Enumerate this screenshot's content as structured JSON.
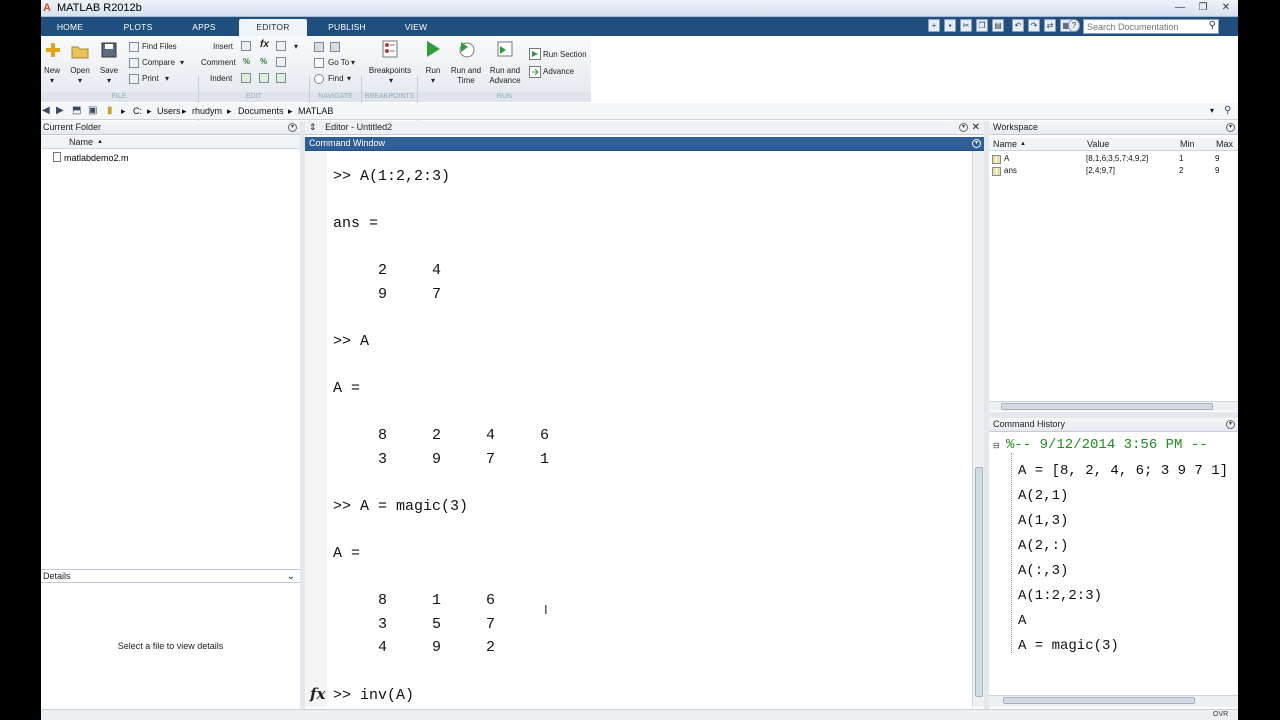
{
  "window": {
    "title": "MATLAB R2012b",
    "logo_glyph": "A"
  },
  "tabs": [
    {
      "label": "HOME",
      "active": false
    },
    {
      "label": "PLOTS",
      "active": false
    },
    {
      "label": "APPS",
      "active": false
    },
    {
      "label": "EDITOR",
      "active": true
    },
    {
      "label": "PUBLISH",
      "active": false
    },
    {
      "label": "VIEW",
      "active": false
    }
  ],
  "search": {
    "placeholder": "Search Documentation"
  },
  "ribbon": {
    "file": {
      "new": "New",
      "open": "Open",
      "save": "Save",
      "find_files": "Find Files",
      "compare": "Compare",
      "print": "Print",
      "section": "FILE"
    },
    "edit": {
      "insert": "Insert",
      "comment": "Comment",
      "indent": "Indent",
      "section": "EDIT"
    },
    "navigate": {
      "go_to": "Go To",
      "find": "Find",
      "section": "NAVIGATE"
    },
    "breakpoints": {
      "breakpoints": "Breakpoints",
      "section": "BREAKPOINTS"
    },
    "run": {
      "run": "Run",
      "run_and_time": [
        "Run and",
        "Time"
      ],
      "run_and_advance": [
        "Run and",
        "Advance"
      ],
      "run_section": "Run Section",
      "advance": "Advance",
      "section": "RUN"
    }
  },
  "address": {
    "crumbs": [
      "C:",
      "Users",
      "rhudym",
      "Documents",
      "MATLAB"
    ]
  },
  "current_folder": {
    "title": "Current Folder",
    "column": "Name",
    "sort_glyph": "▲",
    "files": [
      "matlabdemo2.m"
    ]
  },
  "details": {
    "title": "Details",
    "message": "Select a file to view details"
  },
  "editor": {
    "title": "Editor - Untitled2"
  },
  "command_window": {
    "title": "Command Window",
    "prompt_glyph": "fx",
    "lines": [
      ">> A(1:2,2:3)",
      "ans =",
      "     2     4",
      "     9     7",
      ">> A",
      "A =",
      "     8     2     4     6",
      "     3     9     7     1",
      ">> A = magic(3)",
      "A =",
      "     8     1     6",
      "     3     5     7",
      "     4     9     2",
      ">> inv(A)"
    ]
  },
  "workspace": {
    "title": "Workspace",
    "columns": [
      "Name",
      "Value",
      "Min",
      "Max"
    ],
    "rows": [
      {
        "name": "A",
        "value": "[8,1,6;3,5,7;4,9,2]",
        "min": "1",
        "max": "9"
      },
      {
        "name": "ans",
        "value": "[2,4;9,7]",
        "min": "2",
        "max": "9"
      }
    ]
  },
  "history": {
    "title": "Command History",
    "session": "%-- 9/12/2014 3:56 PM --",
    "entries": [
      "A = [8, 2, 4, 6; 3 9 7 1]",
      "A(2,1)",
      "A(1,3)",
      "A(2,:)",
      "A(:,3)",
      "A(1:2,2:3)",
      "A",
      "A = magic(3)"
    ]
  },
  "status": {
    "mode": "OVR"
  },
  "colors": {
    "tabstrip": "#1f4f7f",
    "pane_title": "#2f5f96",
    "history_comment": "#228b22"
  }
}
